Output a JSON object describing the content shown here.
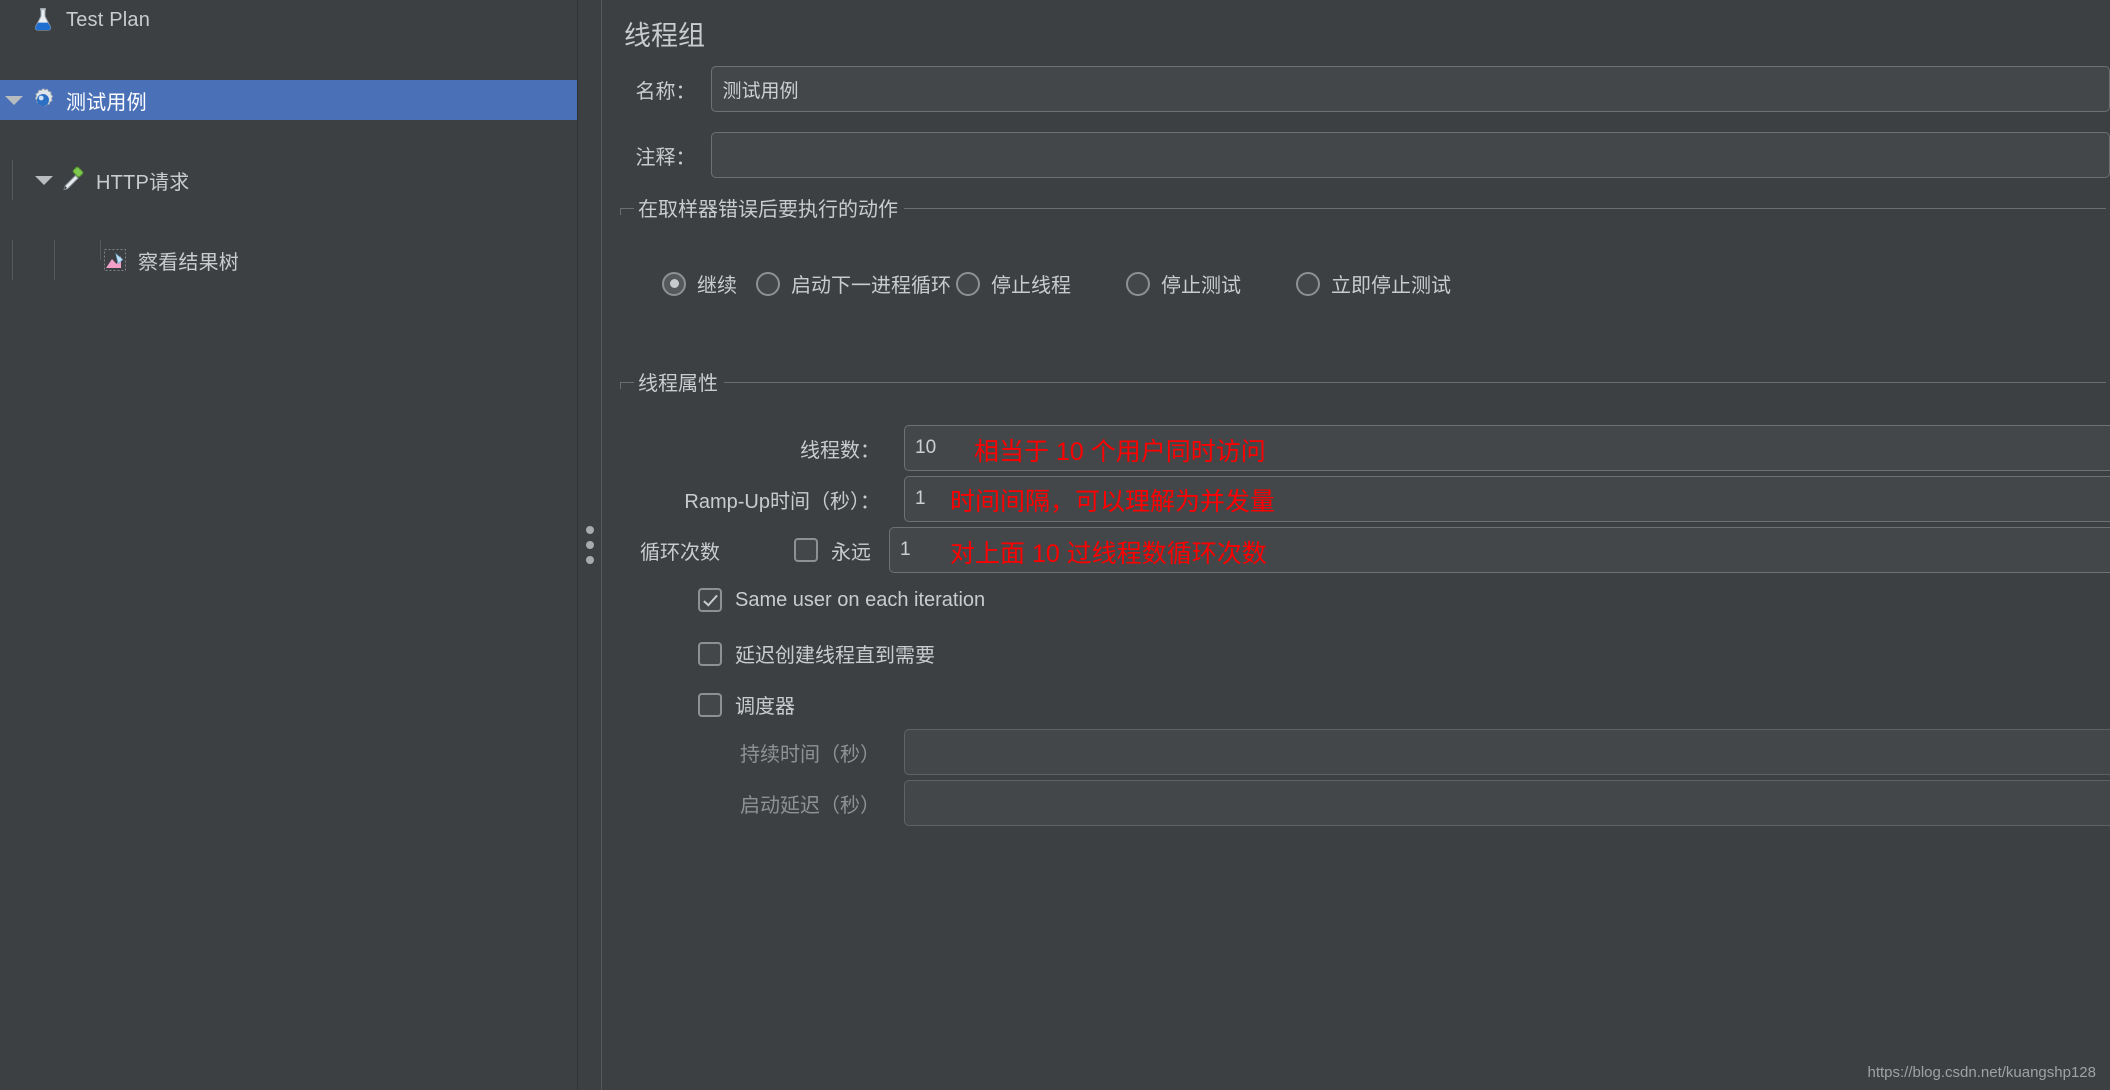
{
  "window": {
    "background_color": "#3c4043",
    "selection_color": "#4a71b8",
    "accent_red": "#ff0000"
  },
  "tree": {
    "items": [
      {
        "label": "Test Plan",
        "icon": "flask-icon",
        "depth": 0,
        "expanded": null,
        "selected": false
      },
      {
        "label": "测试用例",
        "icon": "gear-icon",
        "depth": 0,
        "expanded": true,
        "selected": true
      },
      {
        "label": "HTTP请求",
        "icon": "pipette-icon",
        "depth": 1,
        "expanded": true,
        "selected": false
      },
      {
        "label": "察看结果树",
        "icon": "results-tree-icon",
        "depth": 2,
        "expanded": null,
        "selected": false
      }
    ]
  },
  "panel": {
    "title": "线程组",
    "name_field": {
      "label": "名称：",
      "value": "测试用例",
      "placeholder": ""
    },
    "comment_field": {
      "label": "注释：",
      "value": "",
      "placeholder": ""
    },
    "error_action_group": {
      "legend": "在取样器错误后要执行的动作",
      "options": [
        {
          "label": "继续",
          "selected": true
        },
        {
          "label": "启动下一进程循环",
          "selected": false
        },
        {
          "label": "停止线程",
          "selected": false
        },
        {
          "label": "停止测试",
          "selected": false
        },
        {
          "label": "立即停止测试",
          "selected": false
        }
      ]
    },
    "thread_properties_group": {
      "legend": "线程属性",
      "thread_count": {
        "label": "线程数：",
        "value": "10",
        "annotation": "相当于 10 个用户同时访问"
      },
      "ramp_up": {
        "label": "Ramp-Up时间（秒）：",
        "value": "1",
        "annotation": "时间间隔，可以理解为并发量"
      },
      "loop_count": {
        "label": "循环次数",
        "forever_label": "永远",
        "forever_checked": false,
        "value": "1",
        "annotation": "对上面 10 过线程数循环次数"
      },
      "checkboxes": [
        {
          "label": "Same user on each iteration",
          "checked": true
        },
        {
          "label": "延迟创建线程直到需要",
          "checked": false
        },
        {
          "label": "调度器",
          "checked": false
        }
      ],
      "duration": {
        "label": "持续时间（秒）",
        "value": "",
        "disabled": true
      },
      "startup_delay": {
        "label": "启动延迟（秒）",
        "value": "",
        "disabled": true
      }
    }
  },
  "watermark": {
    "text": "https://blog.csdn.net/kuangshp128"
  }
}
